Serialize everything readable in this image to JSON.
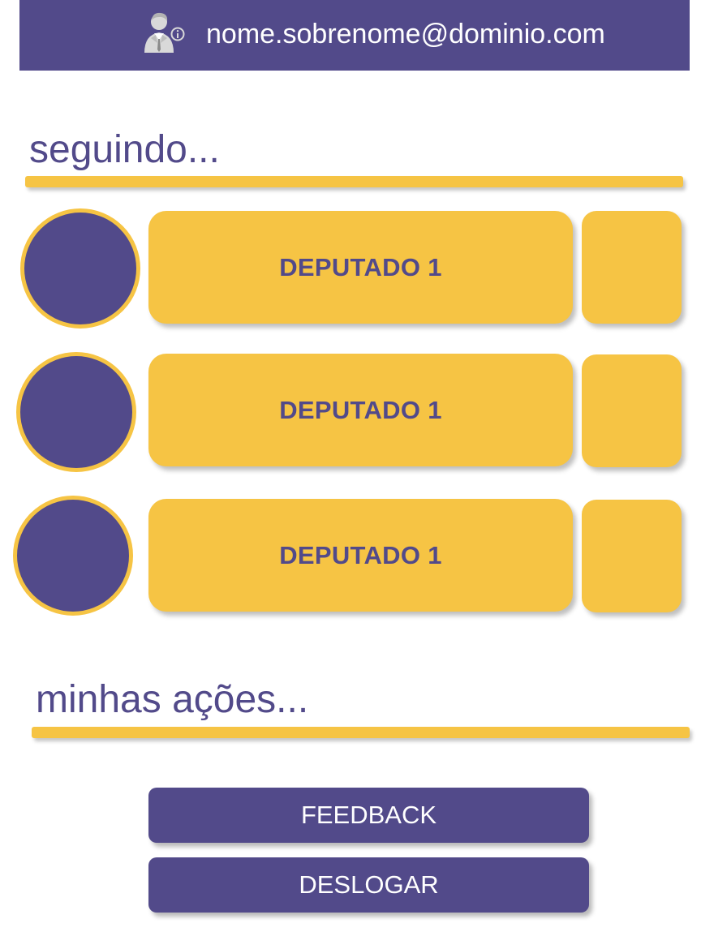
{
  "header": {
    "email": "nome.sobrenome@dominio.com",
    "icon": "user-info-icon"
  },
  "following": {
    "title": "seguindo...",
    "items": [
      {
        "label": "DEPUTADO 1"
      },
      {
        "label": "DEPUTADO 1"
      },
      {
        "label": "DEPUTADO 1"
      }
    ]
  },
  "actions": {
    "title": "minhas ações...",
    "feedback_label": "FEEDBACK",
    "logout_label": "DESLOGAR"
  },
  "colors": {
    "primary": "#524a8a",
    "accent": "#f6c444",
    "text_on_primary": "#ffffff"
  }
}
